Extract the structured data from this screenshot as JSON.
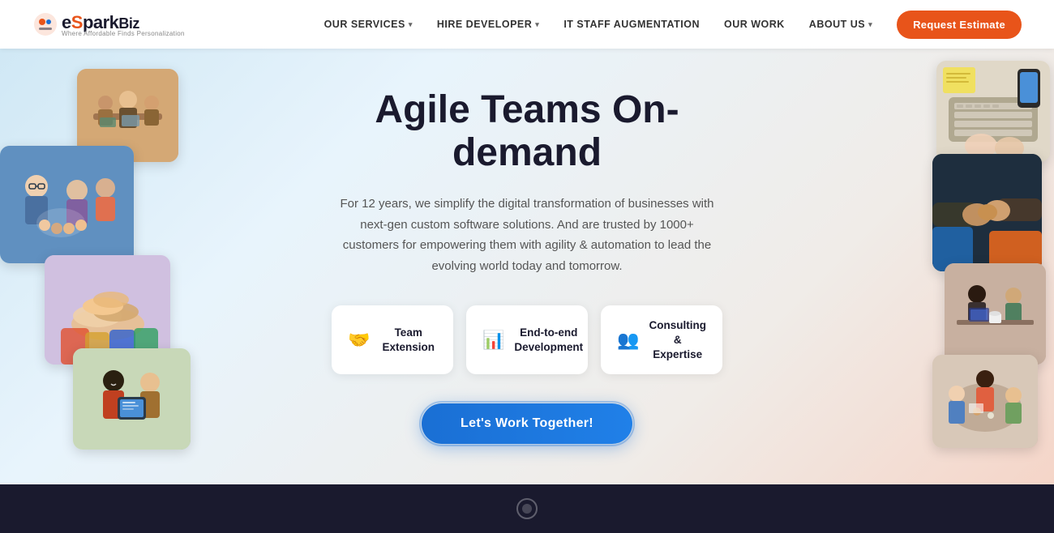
{
  "logo": {
    "brand": "eSpark",
    "suffix": "Biz",
    "tagline": "Where Affordable Finds Personalization"
  },
  "nav": {
    "links": [
      {
        "id": "our-services",
        "label": "OUR SERVICES",
        "hasDropdown": true
      },
      {
        "id": "hire-developer",
        "label": "HIRE DEVELOPER",
        "hasDropdown": true
      },
      {
        "id": "it-staff",
        "label": "IT STAFF AUGMENTATION",
        "hasDropdown": false
      },
      {
        "id": "our-work",
        "label": "OUR WORK",
        "hasDropdown": false
      },
      {
        "id": "about-us",
        "label": "ABOUT US",
        "hasDropdown": true
      }
    ],
    "cta": "Request Estimate"
  },
  "hero": {
    "title": "Agile Teams On-demand",
    "subtitle": "For 12 years, we simplify the digital transformation of businesses with next-gen custom software solutions. And are trusted by 1000+ customers for empowering them with agility & automation to lead the evolving world today and tomorrow.",
    "services": [
      {
        "id": "team-extension",
        "icon": "🤝",
        "label": "Team Extension"
      },
      {
        "id": "end-to-end",
        "icon": "📊",
        "label": "End-to-end Development"
      },
      {
        "id": "consulting",
        "icon": "👥",
        "label": "Consulting & Expertise"
      }
    ],
    "cta_button": "Let's Work Together!"
  },
  "footer": {
    "bg": "#1a1a2e"
  },
  "colors": {
    "brand_orange": "#e8541a",
    "brand_blue": "#1a6fd4",
    "nav_bg": "#ffffff",
    "hero_bg_start": "#c8e0f0",
    "hero_bg_end": "#f5d0c0",
    "dark_navy": "#1a1a2e"
  }
}
